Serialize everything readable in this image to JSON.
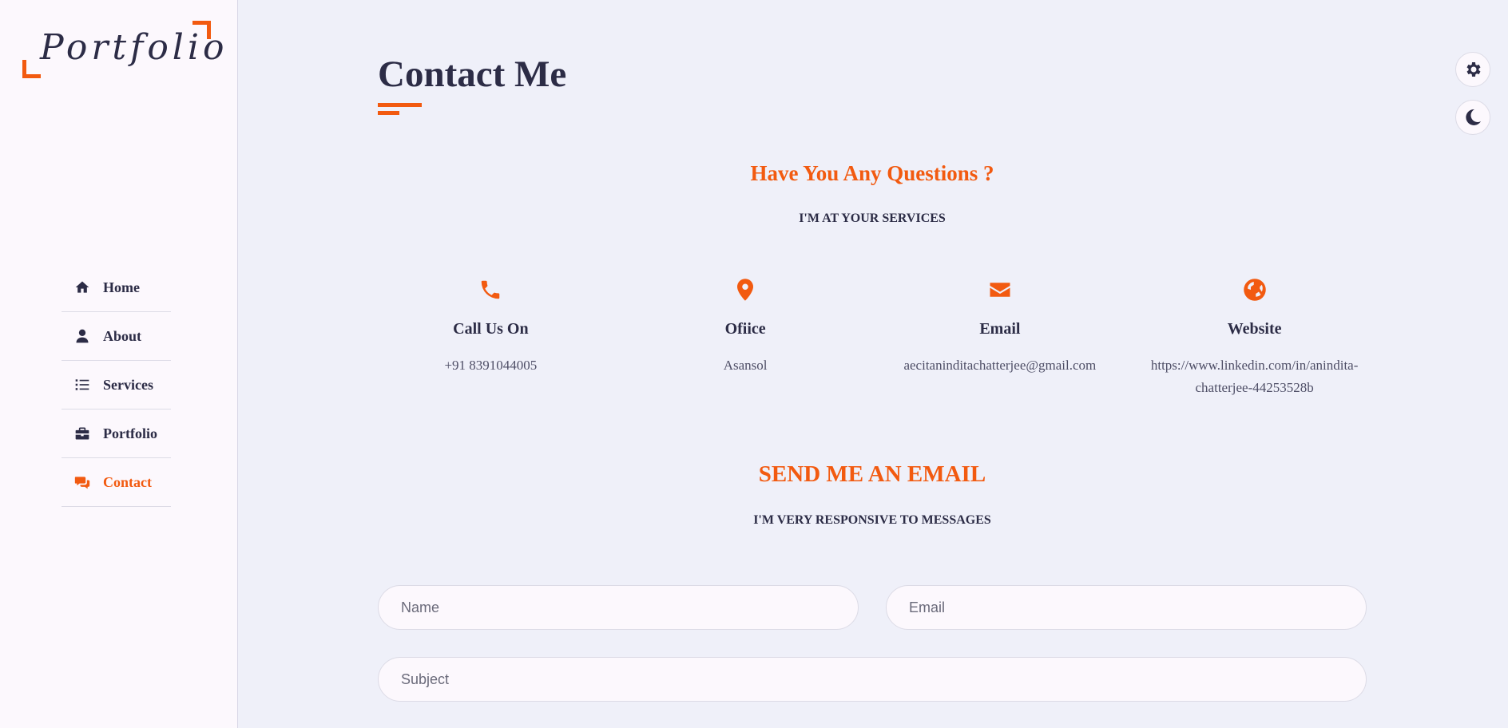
{
  "logo": {
    "text": "Portfolio"
  },
  "nav": [
    {
      "label": "Home",
      "icon": "home-icon"
    },
    {
      "label": "About",
      "icon": "user-icon"
    },
    {
      "label": "Services",
      "icon": "list-icon"
    },
    {
      "label": "Portfolio",
      "icon": "briefcase-icon"
    },
    {
      "label": "Contact",
      "icon": "chat-icon",
      "active": true
    }
  ],
  "page": {
    "title": "Contact Me"
  },
  "questions": {
    "title": "Have You Any Questions ?",
    "subtitle": "I'M AT YOUR SERVICES"
  },
  "cards": [
    {
      "icon": "phone-icon",
      "title": "Call Us On",
      "value": "+91 8391044005"
    },
    {
      "icon": "map-pin-icon",
      "title": "Ofiice",
      "value": "Asansol"
    },
    {
      "icon": "envelope-icon",
      "title": "Email",
      "value": "aecitaninditachatterjee@gmail.com"
    },
    {
      "icon": "globe-icon",
      "title": "Website",
      "value": "https://www.linkedin.com/in/anindita-chatterjee-44253528b"
    }
  ],
  "email_section": {
    "title": "SEND ME AN EMAIL",
    "subtitle": "I'M VERY RESPONSIVE TO MESSAGES"
  },
  "form": {
    "name_placeholder": "Name",
    "email_placeholder": "Email",
    "subject_placeholder": "Subject"
  },
  "floating": {
    "settings_icon": "gear-icon",
    "theme_icon": "moon-icon"
  },
  "colors": {
    "accent": "#f25a10",
    "text": "#2c2c46",
    "background": "#eff0f9",
    "sidebar": "#fcf8fd"
  }
}
